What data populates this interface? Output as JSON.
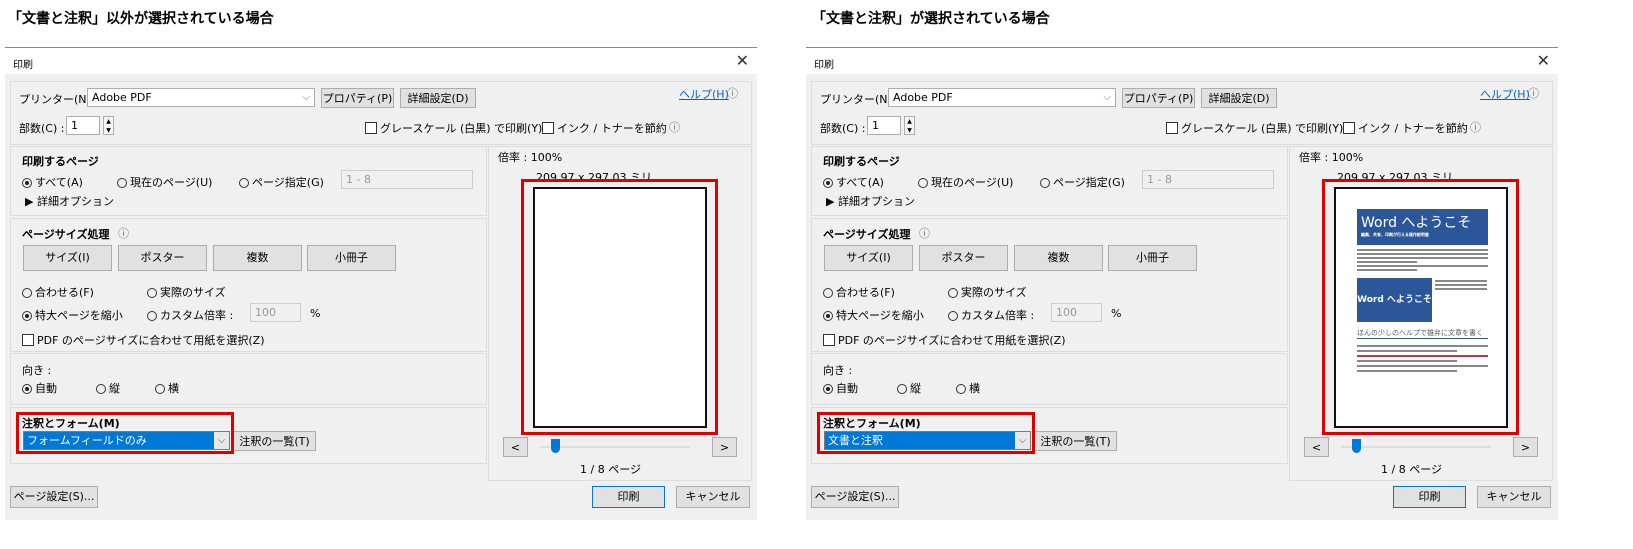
{
  "captions": [
    "「文書と注釈」以外が選択されている場合",
    "「文書と注釈」が選択されている場合"
  ],
  "dialogs": [
    {
      "title": "印刷",
      "close": "✕",
      "printer_label": "プリンター(N) :",
      "printer_value": "Adobe PDF",
      "properties": "プロパティ(P)",
      "advanced": "詳細設定(D)",
      "help": "ヘルプ(H)",
      "copies_label": "部数(C) :",
      "copies_value": "1",
      "grayscale": "グレースケール (白黒) で印刷(Y)",
      "save_ink": "インク / トナーを節約",
      "pages_heading": "印刷するページ",
      "all": "すべて(A)",
      "current": "現在のページ(U)",
      "range": "ページ指定(G)",
      "range_value": "1 - 8",
      "more": "▶ 詳細オプション",
      "size_heading": "ページサイズ処理",
      "size_btn": "サイズ(I)",
      "poster_btn": "ポスター",
      "multiple_btn": "複数",
      "booklet_btn": "小冊子",
      "fit": "合わせる(F)",
      "actual": "実際のサイズ",
      "shrink": "特大ページを縮小",
      "custom": "カスタム倍率 :",
      "custom_value": "100",
      "percent": "%",
      "choose_paper": "PDF のページサイズに合わせて用紙を選択(Z)",
      "orient_heading": "向き :",
      "auto": "自動",
      "portrait": "縦",
      "landscape": "横",
      "annot_heading": "注釈とフォーム(M)",
      "annot_value": "フォームフィールドのみ",
      "summarize": "注釈の一覧(T)",
      "zoom": "倍率 : 100%",
      "paper_size": "209.97 x 297.03 ミリ",
      "prev": "<",
      "next": ">",
      "page_count": "1 / 8 ページ",
      "page_setup": "ページ設定(S)...",
      "print": "印刷",
      "cancel": "キャンセル",
      "slider_fraction": 0
    },
    {
      "title": "印刷",
      "close": "✕",
      "printer_label": "プリンター(N) :",
      "printer_value": "Adobe PDF",
      "properties": "プロパティ(P)",
      "advanced": "詳細設定(D)",
      "help": "ヘルプ(H)",
      "copies_label": "部数(C) :",
      "copies_value": "1",
      "grayscale": "グレースケール (白黒) で印刷(Y)",
      "save_ink": "インク / トナーを節約",
      "pages_heading": "印刷するページ",
      "all": "すべて(A)",
      "current": "現在のページ(U)",
      "range": "ページ指定(G)",
      "range_value": "1 - 8",
      "more": "▶ 詳細オプション",
      "size_heading": "ページサイズ処理",
      "size_btn": "サイズ(I)",
      "poster_btn": "ポスター",
      "multiple_btn": "複数",
      "booklet_btn": "小冊子",
      "fit": "合わせる(F)",
      "actual": "実際のサイズ",
      "shrink": "特大ページを縮小",
      "custom": "カスタム倍率 :",
      "custom_value": "100",
      "percent": "%",
      "choose_paper": "PDF のページサイズに合わせて用紙を選択(Z)",
      "orient_heading": "向き :",
      "auto": "自動",
      "portrait": "縦",
      "landscape": "横",
      "annot_heading": "注釈とフォーム(M)",
      "annot_value": "文書と注釈",
      "summarize": "注釈の一覧(T)",
      "zoom": "倍率 : 100%",
      "paper_size": "209.97 x 297.03 ミリ",
      "prev": "<",
      "next": ">",
      "page_count": "1 / 8 ページ",
      "page_setup": "ページ設定(S)...",
      "print": "印刷",
      "cancel": "キャンセル",
      "slider_fraction": 0,
      "preview": {
        "banner_title": "Word へようこそ",
        "banner_sub": "編集、共有、印刷が行える操作説明書",
        "image_title": "Word へようこそ",
        "section_heading": "ほんの少しのヘルプで雄弁に文章を書く"
      }
    }
  ],
  "colors": {
    "highlight": "#e00000",
    "selection": "#0078d7",
    "word_blue": "#2b579a"
  }
}
